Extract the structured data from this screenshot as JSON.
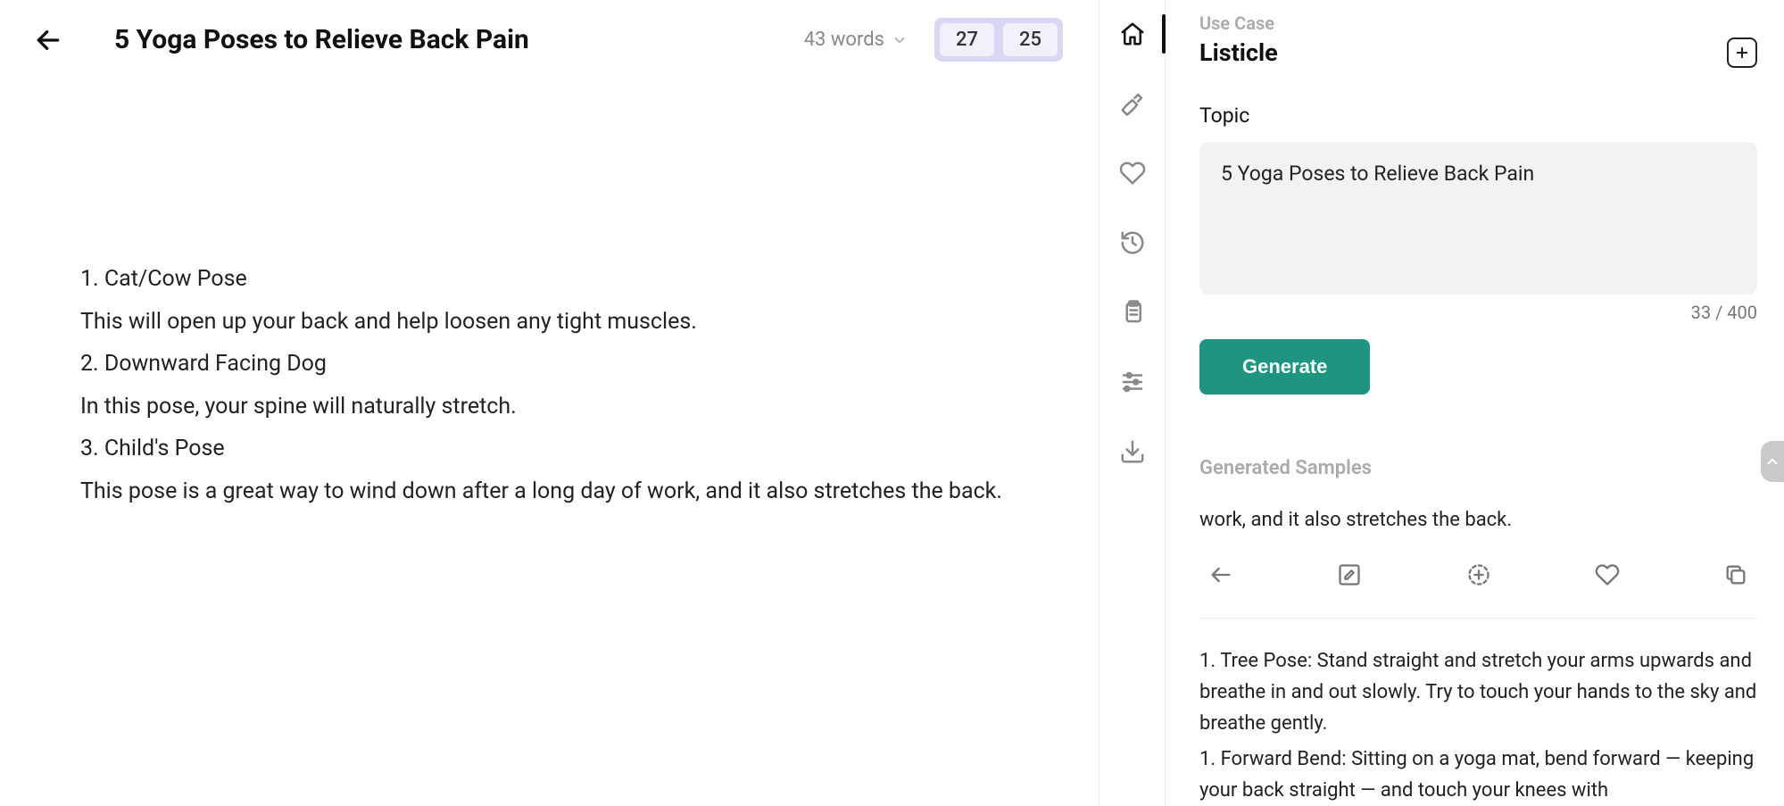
{
  "header": {
    "title": "5 Yoga Poses to Relieve Back Pain",
    "word_count_label": "43 words",
    "pill_a": "27",
    "pill_b": "25"
  },
  "editor": {
    "lines": [
      "1. Cat/Cow Pose",
      "This will open up your back and help loosen any tight muscles.",
      "2. Downward Facing Dog",
      "In this pose, your spine will naturally stretch.",
      "3. Child's Pose",
      "This pose is a great way to wind down after a long day of work, and it also stretches the back."
    ]
  },
  "right": {
    "use_case_label": "Use Case",
    "use_case_value": "Listicle",
    "topic_label": "Topic",
    "topic_value": "5 Yoga Poses to Relieve Back Pain",
    "char_count": "33 / 400",
    "generate_label": "Generate",
    "samples_label": "Generated Samples",
    "sample1_visible": "work, and it also stretches the back.",
    "sample2": "1. Tree Pose: Stand straight and stretch your arms upwards and breathe in and out slowly. Try to touch your hands to the sky and breathe gently.",
    "sample2b": "1. Forward Bend: Sitting on a yoga mat, bend forward — keeping your back straight — and touch your knees with"
  },
  "rail_icons": [
    "home-icon",
    "pen-icon",
    "heart-icon",
    "history-icon",
    "clipboard-icon",
    "sliders-icon",
    "download-icon"
  ]
}
